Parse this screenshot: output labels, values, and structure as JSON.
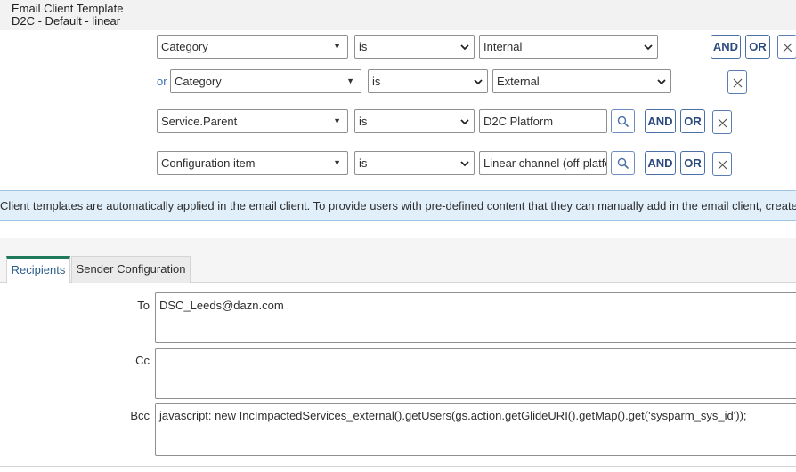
{
  "header": {
    "title": "Email Client Template",
    "subtitle": "D2C - Default - linear"
  },
  "conditions": [
    {
      "prefix": "",
      "field": "Category",
      "operator": "is",
      "value": "Internal",
      "and_label": "AND",
      "or_label": "OR"
    },
    {
      "prefix": "or",
      "field": "Category",
      "operator": "is",
      "value": "External"
    },
    {
      "prefix": "",
      "field": "Service.Parent",
      "operator": "is",
      "value": "D2C Platform",
      "and_label": "AND",
      "or_label": "OR"
    },
    {
      "prefix": "",
      "field": "Configuration item",
      "operator": "is",
      "value": "Linear channel (off-platfc",
      "and_label": "AND",
      "or_label": "OR"
    }
  ],
  "banner": {
    "text": "Client templates are automatically applied in the email client. To provide users with pre-defined content that they can manually add in the email client, create a quick m"
  },
  "tabs": [
    {
      "label": "Recipients",
      "active": true
    },
    {
      "label": "Sender Configuration",
      "active": false
    }
  ],
  "recipients": {
    "to_label": "To",
    "to_value": "DSC_Leeds@dazn.com",
    "cc_label": "Cc",
    "cc_value": "",
    "bcc_label": "Bcc",
    "bcc_value": "javascript: new IncImpactedServices_external().getUsers(gs.action.getGlideURI().getMap().get('sysparm_sys_id'));"
  },
  "colors": {
    "accent": "#1f7a5a",
    "button_border": "#4a6fa5",
    "banner_bg": "#e1effa"
  },
  "icons": [
    "caret-down-icon",
    "chevron-down-icon",
    "close-icon",
    "search-icon"
  ]
}
